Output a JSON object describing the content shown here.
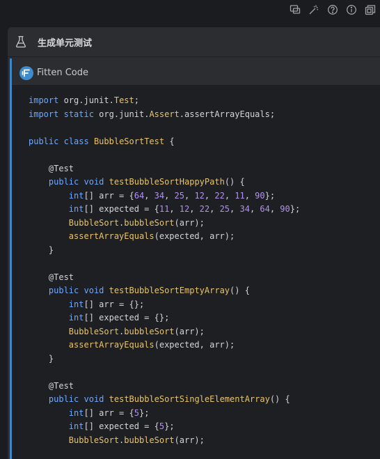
{
  "toolbar": {
    "icons": [
      "chat-icon",
      "magic-wand-icon",
      "help-icon",
      "info-icon",
      "copy-window-icon"
    ]
  },
  "panel": {
    "title": "生成单元测试"
  },
  "message": {
    "author": "Fitten Code"
  },
  "code": {
    "language": "java",
    "lines": [
      [
        {
          "t": "import",
          "c": "kw"
        },
        {
          "t": " org.junit.",
          "c": "pl"
        },
        {
          "t": "Test",
          "c": "ty"
        },
        {
          "t": ";",
          "c": "pl"
        }
      ],
      [
        {
          "t": "import",
          "c": "kw"
        },
        {
          "t": " ",
          "c": "pl"
        },
        {
          "t": "static",
          "c": "kw"
        },
        {
          "t": " org.junit.",
          "c": "pl"
        },
        {
          "t": "Assert",
          "c": "ty"
        },
        {
          "t": ".assertArrayEquals;",
          "c": "pl"
        }
      ],
      [],
      [
        {
          "t": "public",
          "c": "kw"
        },
        {
          "t": " ",
          "c": "pl"
        },
        {
          "t": "class",
          "c": "kw"
        },
        {
          "t": " ",
          "c": "pl"
        },
        {
          "t": "BubbleSortTest",
          "c": "ty"
        },
        {
          "t": " {",
          "c": "pl"
        }
      ],
      [],
      [
        {
          "t": "    @Test",
          "c": "pl"
        }
      ],
      [
        {
          "t": "    ",
          "c": "pl"
        },
        {
          "t": "public",
          "c": "kw"
        },
        {
          "t": " ",
          "c": "pl"
        },
        {
          "t": "void",
          "c": "kw"
        },
        {
          "t": " ",
          "c": "pl"
        },
        {
          "t": "testBubbleSortHappyPath",
          "c": "fn"
        },
        {
          "t": "() {",
          "c": "pl"
        }
      ],
      [
        {
          "t": "        ",
          "c": "pl"
        },
        {
          "t": "int",
          "c": "kw"
        },
        {
          "t": "[] arr = {",
          "c": "pl"
        },
        {
          "t": "64",
          "c": "nu"
        },
        {
          "t": ", ",
          "c": "pl"
        },
        {
          "t": "34",
          "c": "nu"
        },
        {
          "t": ", ",
          "c": "pl"
        },
        {
          "t": "25",
          "c": "nu"
        },
        {
          "t": ", ",
          "c": "pl"
        },
        {
          "t": "12",
          "c": "nu"
        },
        {
          "t": ", ",
          "c": "pl"
        },
        {
          "t": "22",
          "c": "nu"
        },
        {
          "t": ", ",
          "c": "pl"
        },
        {
          "t": "11",
          "c": "nu"
        },
        {
          "t": ", ",
          "c": "pl"
        },
        {
          "t": "90",
          "c": "nu"
        },
        {
          "t": "};",
          "c": "pl"
        }
      ],
      [
        {
          "t": "        ",
          "c": "pl"
        },
        {
          "t": "int",
          "c": "kw"
        },
        {
          "t": "[] expected = {",
          "c": "pl"
        },
        {
          "t": "11",
          "c": "nu"
        },
        {
          "t": ", ",
          "c": "pl"
        },
        {
          "t": "12",
          "c": "nu"
        },
        {
          "t": ", ",
          "c": "pl"
        },
        {
          "t": "22",
          "c": "nu"
        },
        {
          "t": ", ",
          "c": "pl"
        },
        {
          "t": "25",
          "c": "nu"
        },
        {
          "t": ", ",
          "c": "pl"
        },
        {
          "t": "34",
          "c": "nu"
        },
        {
          "t": ", ",
          "c": "pl"
        },
        {
          "t": "64",
          "c": "nu"
        },
        {
          "t": ", ",
          "c": "pl"
        },
        {
          "t": "90",
          "c": "nu"
        },
        {
          "t": "};",
          "c": "pl"
        }
      ],
      [
        {
          "t": "        ",
          "c": "pl"
        },
        {
          "t": "BubbleSort",
          "c": "ty"
        },
        {
          "t": ".",
          "c": "pl"
        },
        {
          "t": "bubbleSort",
          "c": "fn"
        },
        {
          "t": "(arr);",
          "c": "pl"
        }
      ],
      [
        {
          "t": "        ",
          "c": "pl"
        },
        {
          "t": "assertArrayEquals",
          "c": "fn"
        },
        {
          "t": "(expected, arr);",
          "c": "pl"
        }
      ],
      [
        {
          "t": "    }",
          "c": "pl"
        }
      ],
      [],
      [
        {
          "t": "    @Test",
          "c": "pl"
        }
      ],
      [
        {
          "t": "    ",
          "c": "pl"
        },
        {
          "t": "public",
          "c": "kw"
        },
        {
          "t": " ",
          "c": "pl"
        },
        {
          "t": "void",
          "c": "kw"
        },
        {
          "t": " ",
          "c": "pl"
        },
        {
          "t": "testBubbleSortEmptyArray",
          "c": "fn"
        },
        {
          "t": "() {",
          "c": "pl"
        }
      ],
      [
        {
          "t": "        ",
          "c": "pl"
        },
        {
          "t": "int",
          "c": "kw"
        },
        {
          "t": "[] arr = {};",
          "c": "pl"
        }
      ],
      [
        {
          "t": "        ",
          "c": "pl"
        },
        {
          "t": "int",
          "c": "kw"
        },
        {
          "t": "[] expected = {};",
          "c": "pl"
        }
      ],
      [
        {
          "t": "        ",
          "c": "pl"
        },
        {
          "t": "BubbleSort",
          "c": "ty"
        },
        {
          "t": ".",
          "c": "pl"
        },
        {
          "t": "bubbleSort",
          "c": "fn"
        },
        {
          "t": "(arr);",
          "c": "pl"
        }
      ],
      [
        {
          "t": "        ",
          "c": "pl"
        },
        {
          "t": "assertArrayEquals",
          "c": "fn"
        },
        {
          "t": "(expected, arr);",
          "c": "pl"
        }
      ],
      [
        {
          "t": "    }",
          "c": "pl"
        }
      ],
      [],
      [
        {
          "t": "    @Test",
          "c": "pl"
        }
      ],
      [
        {
          "t": "    ",
          "c": "pl"
        },
        {
          "t": "public",
          "c": "kw"
        },
        {
          "t": " ",
          "c": "pl"
        },
        {
          "t": "void",
          "c": "kw"
        },
        {
          "t": " ",
          "c": "pl"
        },
        {
          "t": "testBubbleSortSingleElementArray",
          "c": "fn"
        },
        {
          "t": "() {",
          "c": "pl"
        }
      ],
      [
        {
          "t": "        ",
          "c": "pl"
        },
        {
          "t": "int",
          "c": "kw"
        },
        {
          "t": "[] arr = {",
          "c": "pl"
        },
        {
          "t": "5",
          "c": "nu"
        },
        {
          "t": "};",
          "c": "pl"
        }
      ],
      [
        {
          "t": "        ",
          "c": "pl"
        },
        {
          "t": "int",
          "c": "kw"
        },
        {
          "t": "[] expected = {",
          "c": "pl"
        },
        {
          "t": "5",
          "c": "nu"
        },
        {
          "t": "};",
          "c": "pl"
        }
      ],
      [
        {
          "t": "        ",
          "c": "pl"
        },
        {
          "t": "BubbleSort",
          "c": "ty"
        },
        {
          "t": ".",
          "c": "pl"
        },
        {
          "t": "bubbleSort",
          "c": "fn"
        },
        {
          "t": "(arr);",
          "c": "pl"
        }
      ]
    ]
  }
}
